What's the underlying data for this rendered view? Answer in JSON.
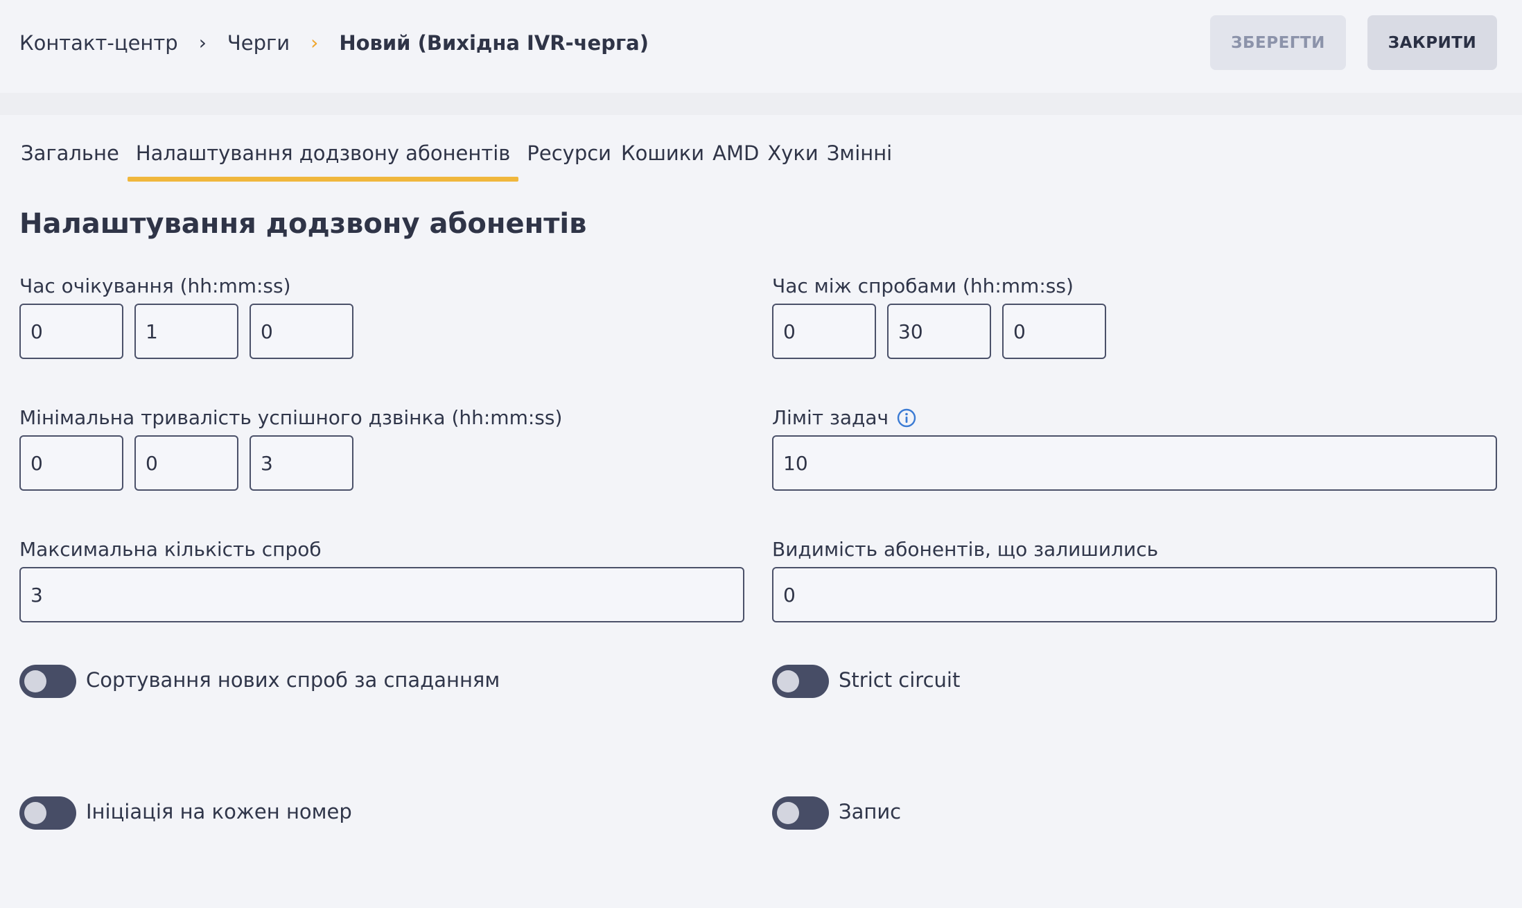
{
  "breadcrumb": {
    "items": [
      "Контакт-центр",
      "Черги"
    ],
    "current": "Новий (Вихідна IVR-черга)"
  },
  "actions": {
    "save_label": "ЗБЕРЕГТИ",
    "close_label": "ЗАКРИТИ"
  },
  "tabs": [
    {
      "label": "Загальне",
      "active": false
    },
    {
      "label": "Налаштування додзвону абонентів",
      "active": true
    },
    {
      "label": "Ресурси",
      "active": false
    },
    {
      "label": "Кошики",
      "active": false
    },
    {
      "label": "AMD",
      "active": false
    },
    {
      "label": "Хуки",
      "active": false
    },
    {
      "label": "Змінні",
      "active": false
    }
  ],
  "section": {
    "title": "Налаштування додзвону абонентів"
  },
  "fields": {
    "wait_time": {
      "label": "Час очікування (hh:mm:ss)",
      "hh": "0",
      "mm": "1",
      "ss": "0"
    },
    "retry_interval": {
      "label": "Час між спробами (hh:mm:ss)",
      "hh": "0",
      "mm": "30",
      "ss": "0"
    },
    "min_call_duration": {
      "label": "Мінімальна тривалість успішного дзвінка (hh:mm:ss)",
      "hh": "0",
      "mm": "0",
      "ss": "3"
    },
    "task_limit": {
      "label": "Ліміт задач",
      "value": "10"
    },
    "max_attempts": {
      "label": "Максимальна кількість спроб",
      "value": "3"
    },
    "remaining_visibility": {
      "label": "Видимість абонентів, що залишились",
      "value": "0"
    }
  },
  "toggles": {
    "sort_desc": {
      "label": "Сортування нових спроб за спаданням",
      "on": false
    },
    "strict_circuit": {
      "label": "Strict circuit",
      "on": false
    },
    "per_number_init": {
      "label": "Ініціація на кожен номер",
      "on": false
    },
    "record": {
      "label": "Запис",
      "on": false
    }
  },
  "colors": {
    "accent": "#f0b73d",
    "toggle_off": "#474d66",
    "info": "#3b7bd4"
  }
}
